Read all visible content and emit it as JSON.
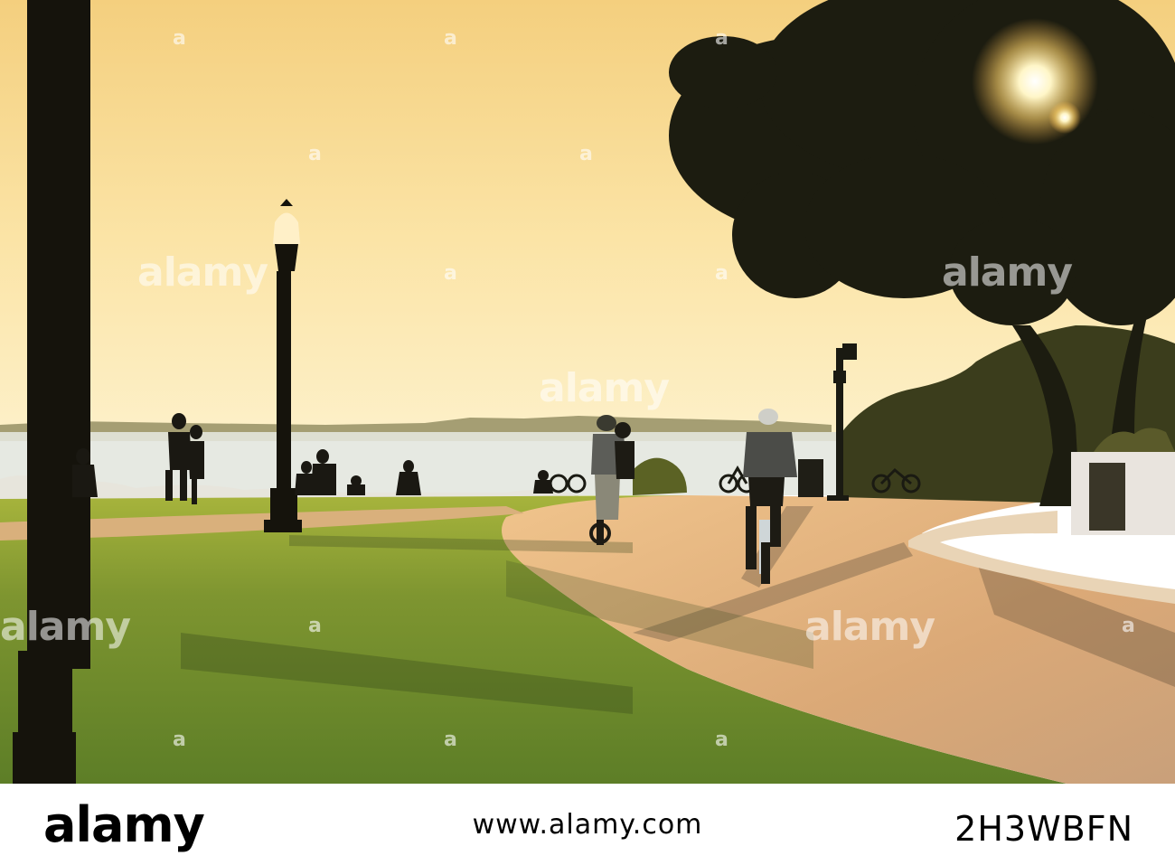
{
  "photo": {
    "description_colors": {
      "sky_top": "#f6d58a",
      "sky_bottom": "#fdf1c4",
      "water": "#e8ebe6",
      "grass": "#6a8a2c",
      "path": "#e0b07e"
    }
  },
  "watermark": {
    "text": "alamy",
    "mark": "a"
  },
  "footer": {
    "logo": "alamy",
    "site": "www.alamy.com",
    "image_id": "2H3WBFN"
  }
}
